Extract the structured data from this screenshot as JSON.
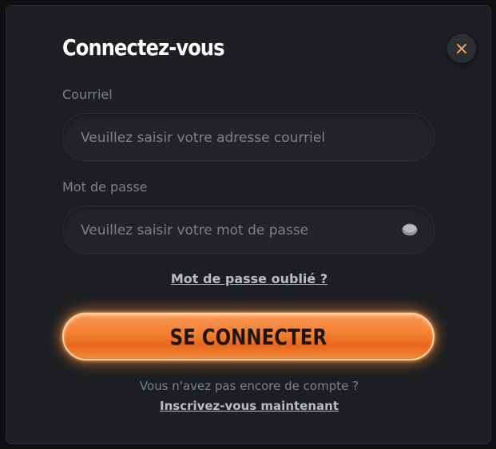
{
  "modal": {
    "title": "Connectez-vous",
    "close_icon": "close-icon",
    "accent_color": "#f47f2f"
  },
  "email": {
    "label": "Courriel",
    "placeholder": "Veuillez saisir votre adresse courriel",
    "value": ""
  },
  "password": {
    "label": "Mot de passe",
    "placeholder": "Veuillez saisir votre mot de passe",
    "value": "",
    "toggle_icon": "eye-icon"
  },
  "forgot_password": "Mot de passe oublié ?",
  "login_button": "SE CONNECTER",
  "signup": {
    "prompt": "Vous n'avez pas encore de compte ?",
    "link": "Inscrivez-vous maintenant"
  }
}
